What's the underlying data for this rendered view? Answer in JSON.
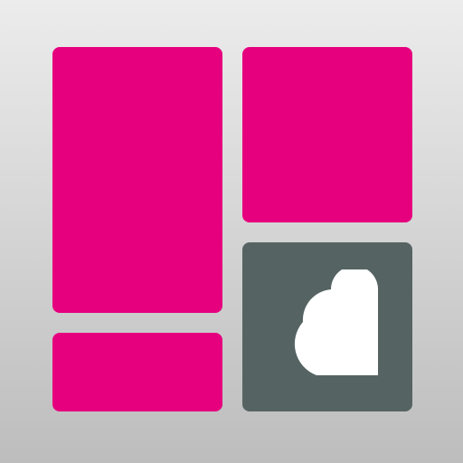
{
  "app_icon": {
    "name": "photo-collage-heart-icon",
    "colors": {
      "background_top": "#ececec",
      "background_bottom": "#bdbdbd",
      "tile_accent": "#e6007e",
      "heart_tile": "#566363",
      "heart": "#ffffff"
    },
    "tiles": [
      "tile-left-tall",
      "tile-right-top",
      "tile-left-bottom",
      "tile-heart"
    ],
    "icons": [
      "heart-icon"
    ]
  }
}
